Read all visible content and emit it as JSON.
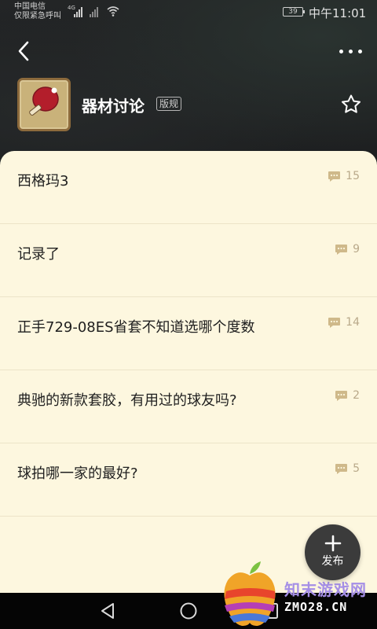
{
  "status_bar": {
    "carrier_line1": "中国电信",
    "carrier_line2": "仅限紧急呼叫",
    "network_tag": "4G",
    "battery": "39",
    "time": "中午11:01"
  },
  "header": {
    "back_icon": "back-chevron-icon",
    "more_icon": "more-dots-icon"
  },
  "forum": {
    "title": "器材讨论",
    "rules_badge": "版规",
    "icon": "ping-pong-paddle-icon",
    "favorite_icon": "star-outline-icon"
  },
  "posts": [
    {
      "title": "西格玛3",
      "comments": "15"
    },
    {
      "title": "记录了",
      "comments": "9"
    },
    {
      "title": "正手729-08ES省套不知道选哪个度数",
      "comments": "14"
    },
    {
      "title": "典驰的新款套胶，有用过的球友吗?",
      "comments": "2"
    },
    {
      "title": "球拍哪一家的最好?",
      "comments": "5"
    }
  ],
  "post_button": {
    "label": "发布",
    "icon": "plus-icon"
  },
  "nav": {
    "back_icon": "nav-back-triangle-icon",
    "home_icon": "nav-home-circle-icon",
    "recent_icon": "nav-recent-square-icon"
  },
  "watermark": {
    "site_cn": "知末游戏网",
    "site_url": "ZMO28.CN"
  },
  "colors": {
    "card_bg": "#fdf7df",
    "comment_icon": "#cfb98a",
    "header_bg": "#1c1d1f"
  }
}
